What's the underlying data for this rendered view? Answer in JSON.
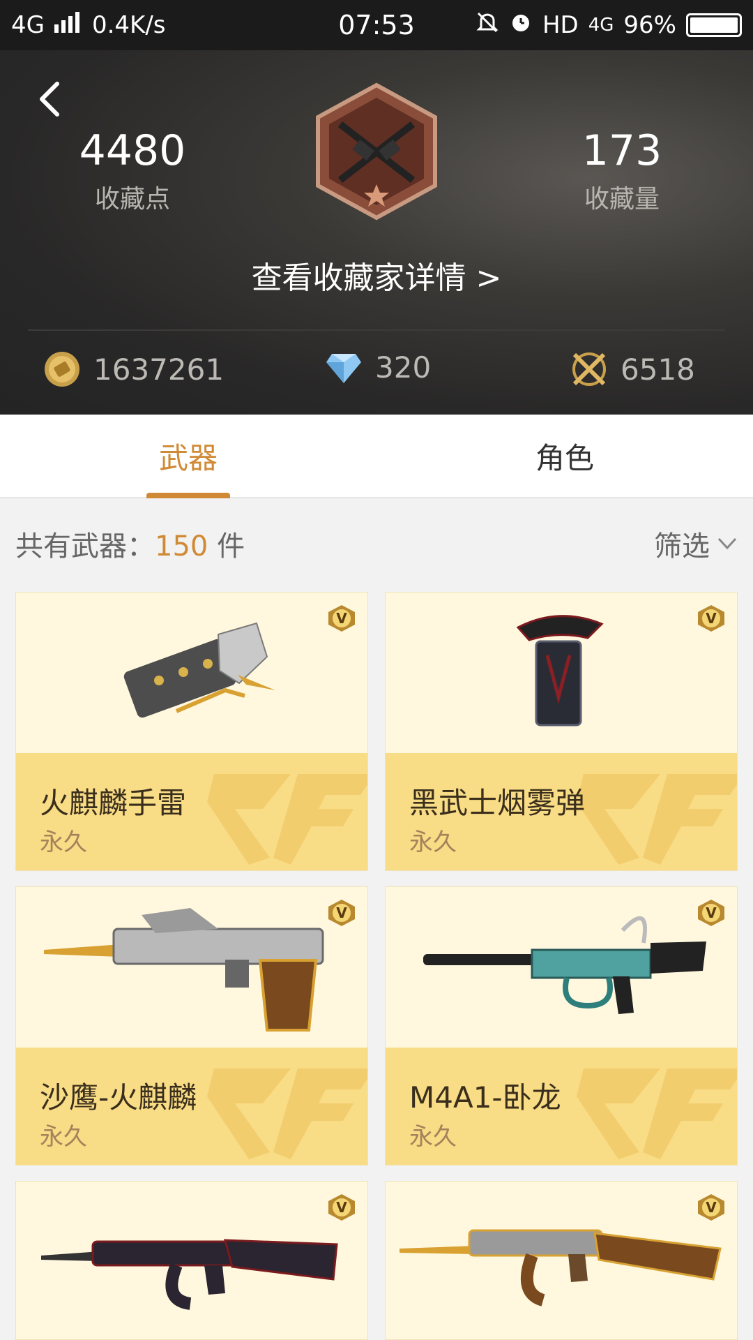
{
  "status_bar": {
    "network": "4G",
    "speed": "0.4K/s",
    "time": "07:53",
    "hd": "HD",
    "network_right": "4G",
    "battery": "96%"
  },
  "profile": {
    "collect_points": "4480",
    "collect_points_label": "收藏点",
    "collect_count": "173",
    "collect_count_label": "收藏量",
    "details_link": "查看收藏家详情 >"
  },
  "currencies": [
    {
      "icon": "gold-coin-icon",
      "value": "1637261"
    },
    {
      "icon": "diamond-icon",
      "value": "320"
    },
    {
      "icon": "crossed-guns-icon",
      "value": "6518"
    }
  ],
  "tabs": [
    {
      "label": "武器",
      "active": true
    },
    {
      "label": "角色",
      "active": false
    }
  ],
  "summary": {
    "prefix": "共有武器：",
    "count": "150",
    "unit": " 件",
    "filter_label": "筛选"
  },
  "items": [
    {
      "name": "火麒麟手雷",
      "duration": "永久"
    },
    {
      "name": "黑武士烟雾弹",
      "duration": "永久"
    },
    {
      "name": "沙鹰-火麒麟",
      "duration": "永久"
    },
    {
      "name": "M4A1-卧龙",
      "duration": "永久"
    },
    {
      "name": "",
      "duration": ""
    },
    {
      "name": "",
      "duration": ""
    }
  ],
  "colors": {
    "accent": "#d08a35",
    "card_top": "#fff8de",
    "card_bottom": "#f9dc86"
  }
}
